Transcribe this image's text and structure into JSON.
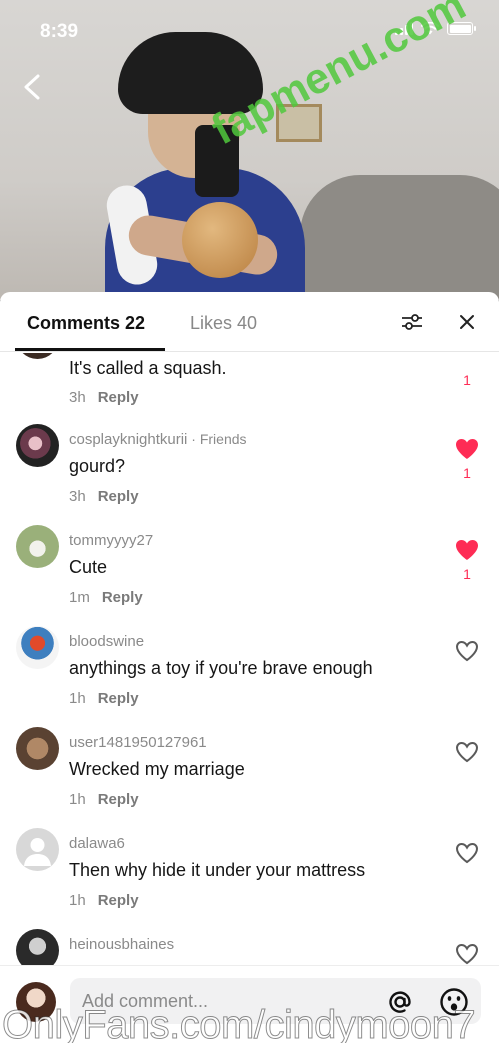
{
  "status_bar": {
    "time": "8:39"
  },
  "watermark_top": "fapmenu.com",
  "watermark_bottom": "OnlyFans.com/cindymoon7",
  "tabs": {
    "comments_label": "Comments 22",
    "likes_label": "Likes 40"
  },
  "comments": [
    {
      "username": "",
      "text": "It's called a squash.",
      "time": "3h",
      "reply": "Reply",
      "liked": true,
      "likes": "1"
    },
    {
      "username": "cosplayknightkurii",
      "friends_tag": " · Friends",
      "text": "gourd?",
      "time": "3h",
      "reply": "Reply",
      "liked": true,
      "likes": "1"
    },
    {
      "username": "tommyyyy27",
      "text": "Cute",
      "time": "1m",
      "reply": "Reply",
      "liked": true,
      "likes": "1"
    },
    {
      "username": "bloodswine",
      "text": "anythings a toy if you're brave enough",
      "time": "1h",
      "reply": "Reply",
      "liked": false,
      "likes": ""
    },
    {
      "username": "user1481950127961",
      "text": "Wrecked my marriage",
      "time": "1h",
      "reply": "Reply",
      "liked": false,
      "likes": ""
    },
    {
      "username": "dalawa6",
      "text": "Then why hide it under your mattress",
      "time": "1h",
      "reply": "Reply",
      "liked": false,
      "likes": ""
    },
    {
      "username": "heinousbhaines",
      "text": "",
      "time": "",
      "reply": "",
      "liked": false,
      "likes": ""
    }
  ],
  "input": {
    "placeholder": "Add comment..."
  },
  "colors": {
    "like_red": "#fe2c55",
    "muted_text": "#8a8a8a",
    "sheet_bg": "#ffffff"
  }
}
